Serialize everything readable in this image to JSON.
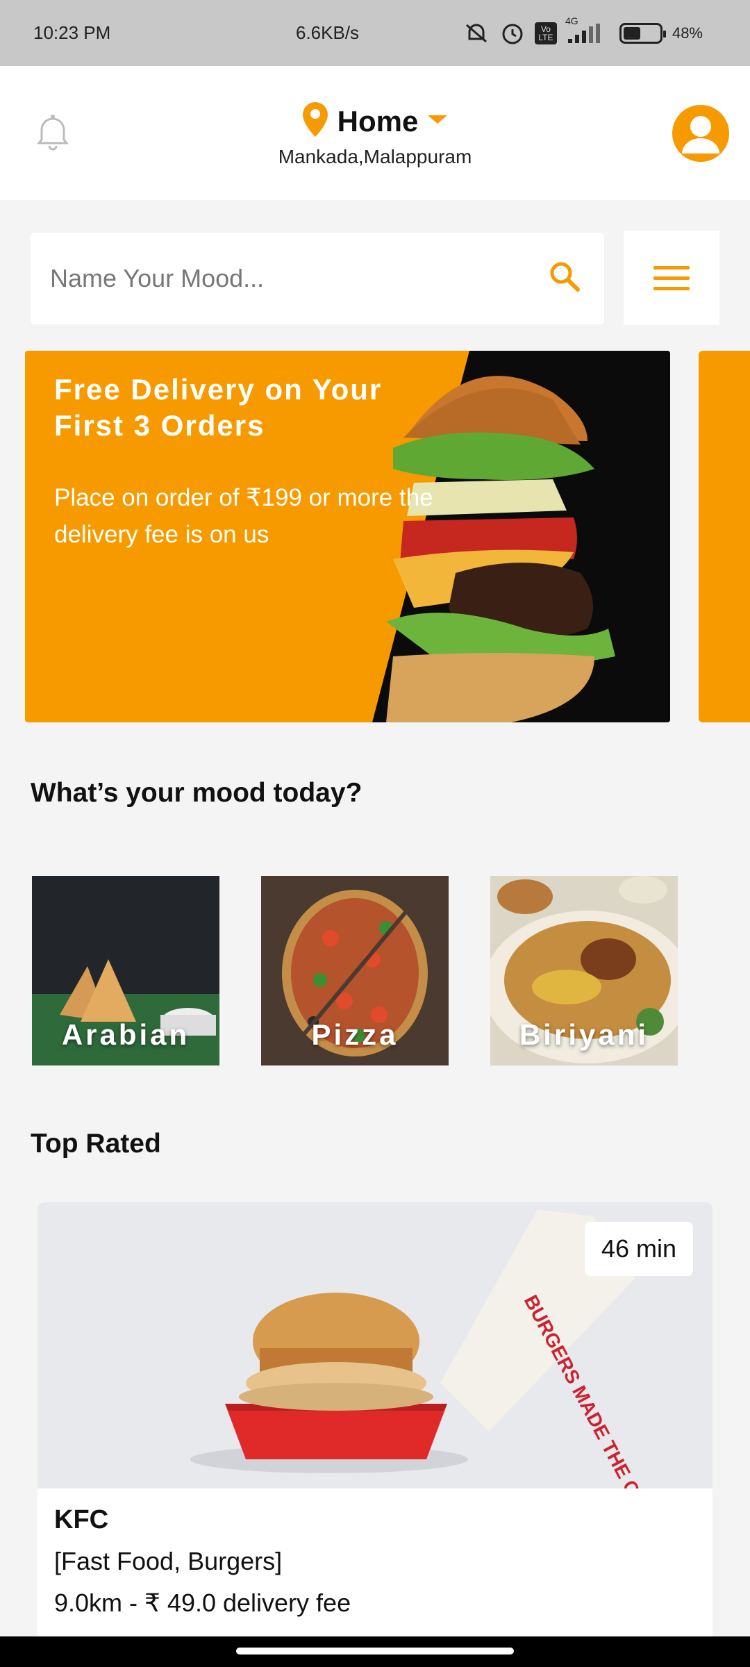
{
  "status_bar": {
    "time": "10:23 PM",
    "net_speed": "6.6KB/s",
    "network": "4G",
    "volte": "Vo LTE",
    "battery": "48%",
    "battery_level": 0.48
  },
  "header": {
    "location_title": "Home",
    "location_subtitle": "Mankada,Malappuram",
    "accent_color": "#f79a00"
  },
  "search": {
    "placeholder": "Name Your Mood..."
  },
  "banner": {
    "title": "Free Delivery on Your First 3 Orders",
    "subtitle": "Place on order of ₹199 or more the delivery fee is on us"
  },
  "mood_section": {
    "title": "What’s your mood today?",
    "items": [
      {
        "label": "Arabian"
      },
      {
        "label": "Pizza"
      },
      {
        "label": "Biriyani"
      }
    ]
  },
  "top_rated": {
    "title": "Top Rated",
    "restaurants": [
      {
        "name": "KFC",
        "categories": "[Fast Food, Burgers]",
        "meta": "9.0km - ₹ 49.0 delivery fee",
        "time": "46 min",
        "box_text": "BURGERS MADE THE COLONEL'S WAY"
      }
    ]
  }
}
